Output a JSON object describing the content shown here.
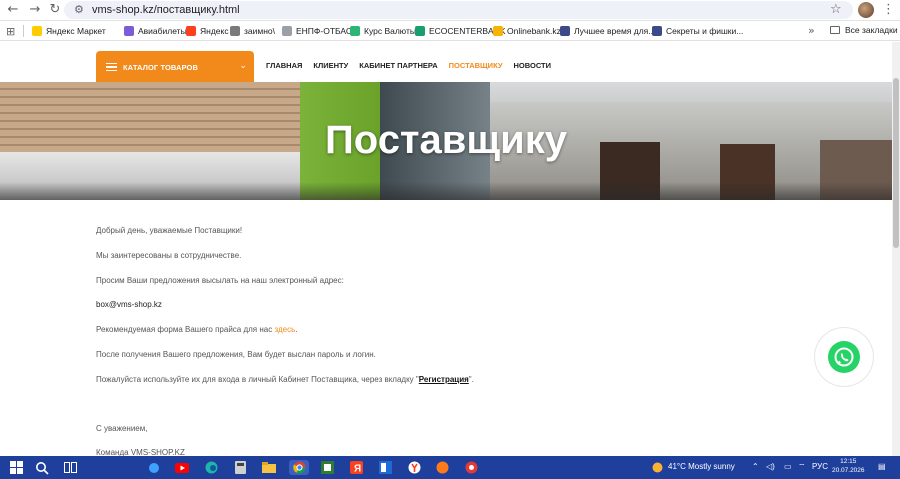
{
  "browser": {
    "url": "vms-shop.kz/поставщику.html",
    "back_icon": "back-arrow-icon",
    "forward_icon": "forward-arrow-icon",
    "reload_icon": "reload-icon"
  },
  "bookmarks": {
    "items": [
      {
        "label": "Яндекс Маркет",
        "color": "#ffcc00"
      },
      {
        "label": "Авиабилеты",
        "color": "#7b5cd6"
      },
      {
        "label": "Яндекс",
        "color": "#fc3f1d"
      },
      {
        "label": "заимно\\",
        "color": "#7a7a7a"
      },
      {
        "label": "ЕНПФ-ОТБАСЫ",
        "color": "#9aa0a6"
      },
      {
        "label": "Курс Валюты",
        "color": "#2bb673"
      },
      {
        "label": "ECOCENTERBANK",
        "color": "#1a9e6e"
      },
      {
        "label": "Onlinebank.kz",
        "color": "#f4b400"
      },
      {
        "label": "Лучшее время для...",
        "color": "#3c4a8a"
      },
      {
        "label": "Секреты и фишки...",
        "color": "#3c4a8a"
      }
    ],
    "all_bookmarks": "Все закладки"
  },
  "site": {
    "catalog_label": "КАТАЛОГ ТОВАРОВ",
    "nav": [
      "ГЛАВНАЯ",
      "КЛИЕНТУ",
      "КАБИНЕТ ПАРТНЕРА",
      "ПОСТАВЩИКУ",
      "НОВОСТИ"
    ],
    "active_nav_index": 3,
    "accent_color": "#f28a1b",
    "hero_title": "Поставщику"
  },
  "content": {
    "greeting": "Добрый день, уважаемые Поставщики!",
    "interest": "Мы заинтересованы в сотрудничестве.",
    "request": "Просим Ваши предложения высылать на наш электронный адрес:",
    "email": "box@vms-shop.kz",
    "form_prefix": "Рекомендуемая форма Вашего прайса для нас ",
    "form_link": "здесь",
    "form_suffix": ".",
    "after": "После получения Вашего предложения, Вам будет выслан пароль и логин.",
    "login_prefix": "Пожалуйста используйте их для входа в личный Кабинет Поставщика, через вкладку \"",
    "login_link": "Регистрация",
    "login_suffix": "\".",
    "regards": "С уважением,",
    "team": "Команда VMS-SHOP.KZ"
  },
  "taskbar": {
    "weather": "41°C  Mostly sunny",
    "lang": "РУС",
    "time": "12:15",
    "date": "20.07.2026"
  }
}
